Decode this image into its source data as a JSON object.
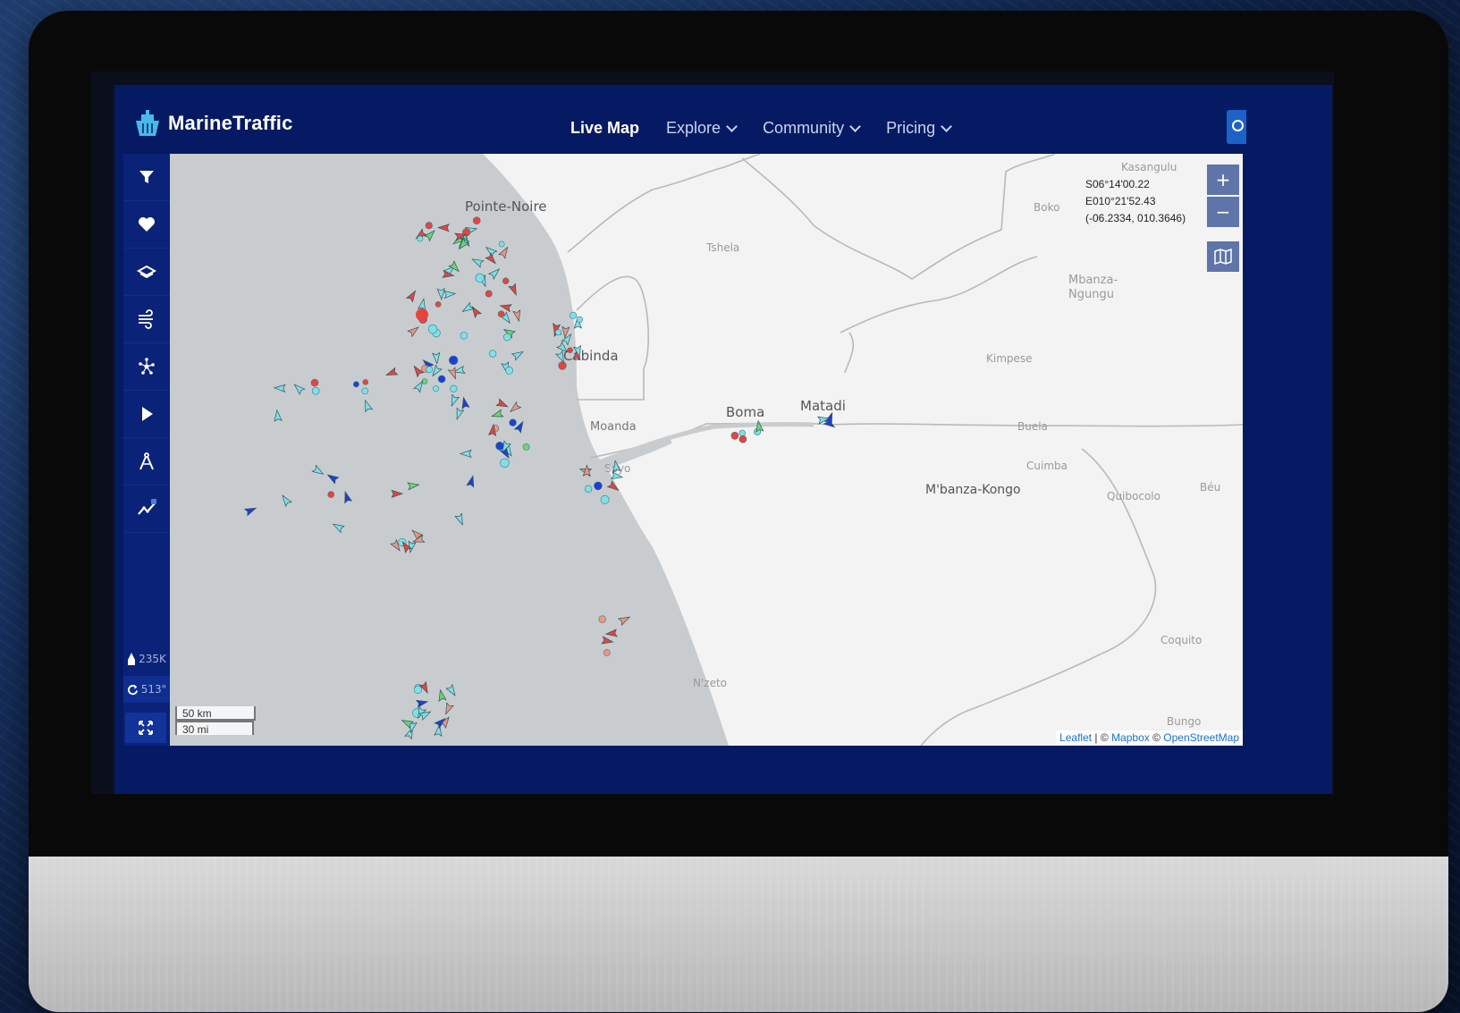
{
  "brand": {
    "name": "MarineTraffic"
  },
  "nav": {
    "live_map": "Live Map",
    "explore": "Explore",
    "community": "Community",
    "pricing": "Pricing"
  },
  "sidebar": {
    "buttons": [
      "filter",
      "favorites",
      "layers",
      "weather",
      "density",
      "play",
      "measure",
      "analytics"
    ],
    "vessel_count": "235K",
    "refresh_timer": "513\""
  },
  "map": {
    "coords": {
      "lat": "S06°14'00.22",
      "lon": "E010°21'52.43",
      "decimal": "(-06.2334, 010.3646)"
    },
    "zoom_in": "+",
    "zoom_out": "−",
    "scale": {
      "km": "50 km",
      "mi": "30 mi"
    },
    "attribution": {
      "leaflet": "Leaflet",
      "sep": " | © ",
      "mapbox": "Mapbox",
      "sep2": " © ",
      "osm": "OpenStreetMap"
    },
    "places": {
      "pointe_noire": "Pointe-Noire",
      "cabinda": "Cabinda",
      "boma": "Boma",
      "matadi": "Matadi",
      "moanda": "Moanda",
      "tshela": "Tshela",
      "boko": "Boko",
      "kasangulu": "Kasangulu",
      "mbanza_ngungu": "Mbanza-\nNgungu",
      "kimpese": "Kimpese",
      "buela": "Buela",
      "cuimba": "Cuimba",
      "mbanza_kongo": "M'banza-Kongo",
      "quibocolo": "Quibocolo",
      "beu": "Béu",
      "soyo": "Soyo",
      "nzeto": "N'zeto",
      "coquito": "Coquito",
      "bungo": "Bungo"
    }
  },
  "colors": {
    "header": "#061a63",
    "sidebar": "#0a2278",
    "ocean": "#c8cccf",
    "land": "#f3f3f3",
    "cargo": "#7fe0e6",
    "tanker": "#e8433d",
    "passenger": "#1f3fd0",
    "fishing": "#f0957e",
    "pleasure": "#6cd66f"
  }
}
